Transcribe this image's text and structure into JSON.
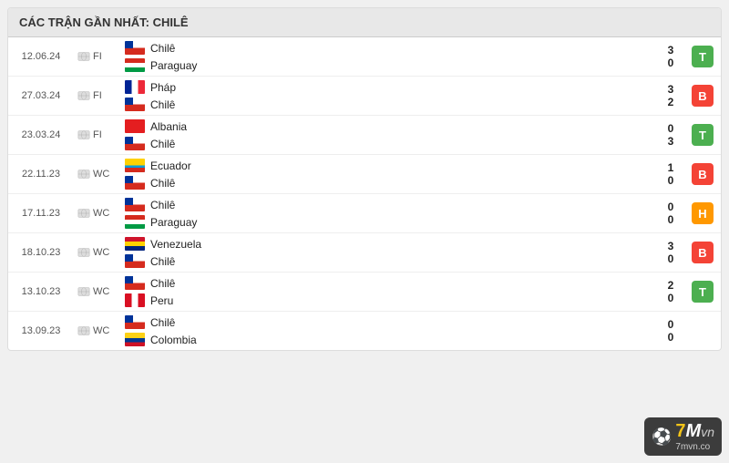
{
  "header": {
    "title": "CÁC TRẬN GẦN NHẤT: CHILÊ"
  },
  "matches": [
    {
      "date": "12.06.24",
      "type": "FI",
      "team1": {
        "name": "Chilê",
        "flag": "chile"
      },
      "team2": {
        "name": "Paraguay",
        "flag": "paraguay"
      },
      "score1": "3",
      "score2": "0",
      "result": "T"
    },
    {
      "date": "27.03.24",
      "type": "FI",
      "team1": {
        "name": "Pháp",
        "flag": "france"
      },
      "team2": {
        "name": "Chilê",
        "flag": "chile"
      },
      "score1": "3",
      "score2": "2",
      "result": "B"
    },
    {
      "date": "23.03.24",
      "type": "FI",
      "team1": {
        "name": "Albania",
        "flag": "albania"
      },
      "team2": {
        "name": "Chilê",
        "flag": "chile"
      },
      "score1": "0",
      "score2": "3",
      "result": "T"
    },
    {
      "date": "22.11.23",
      "type": "WC",
      "team1": {
        "name": "Ecuador",
        "flag": "ecuador"
      },
      "team2": {
        "name": "Chilê",
        "flag": "chile"
      },
      "score1": "1",
      "score2": "0",
      "result": "B"
    },
    {
      "date": "17.11.23",
      "type": "WC",
      "team1": {
        "name": "Chilê",
        "flag": "chile"
      },
      "team2": {
        "name": "Paraguay",
        "flag": "paraguay"
      },
      "score1": "0",
      "score2": "0",
      "result": "H"
    },
    {
      "date": "18.10.23",
      "type": "WC",
      "team1": {
        "name": "Venezuela",
        "flag": "venezuela"
      },
      "team2": {
        "name": "Chilê",
        "flag": "chile"
      },
      "score1": "3",
      "score2": "0",
      "result": "B"
    },
    {
      "date": "13.10.23",
      "type": "WC",
      "team1": {
        "name": "Chilê",
        "flag": "chile"
      },
      "team2": {
        "name": "Peru",
        "flag": "peru"
      },
      "score1": "2",
      "score2": "0",
      "result": "T"
    },
    {
      "date": "13.09.23",
      "type": "WC",
      "team1": {
        "name": "Chilê",
        "flag": "chile"
      },
      "team2": {
        "name": "Colombia",
        "flag": "colombia"
      },
      "score1": "0",
      "score2": "0",
      "result": ""
    }
  ],
  "watermark": {
    "brand": "7Mvn",
    "number": "7",
    "letter": "M",
    "domain": "7mvn.co"
  }
}
